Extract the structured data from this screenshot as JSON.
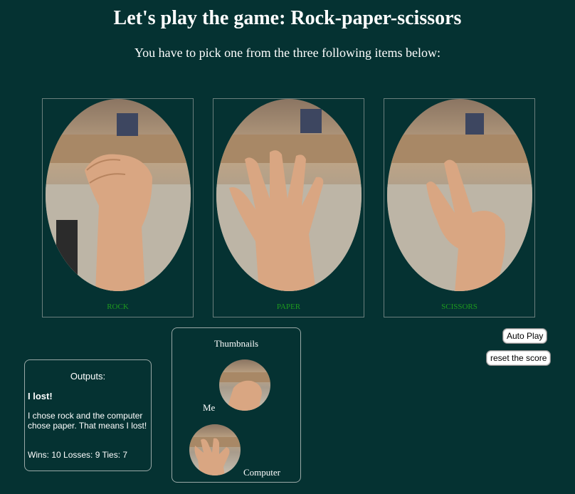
{
  "header": {
    "title": "Let's play the game: Rock-paper-scissors",
    "subtitle": "You have to pick one from the three following items below:"
  },
  "choices": [
    {
      "id": "rock",
      "label": "ROCK",
      "image": "fist-hand-photo"
    },
    {
      "id": "paper",
      "label": "PAPER",
      "image": "open-hand-photo"
    },
    {
      "id": "scissors",
      "label": "SCISSORS",
      "image": "two-fingers-hand-photo"
    }
  ],
  "controls": {
    "auto_play": "Auto Play",
    "reset": "reset the score"
  },
  "outputs": {
    "heading": "Outputs:",
    "result": "I lost!",
    "description": "I chose rock and the computer chose paper. That means I lost!",
    "score": "Wins: 10 Losses: 9 Ties: 7"
  },
  "thumbnails": {
    "heading": "Thumbnails",
    "me_label": "Me",
    "computer_label": "Computer"
  },
  "colors": {
    "background": "#053232",
    "label_green": "#1e9a1e",
    "skin": "#d9a682"
  }
}
